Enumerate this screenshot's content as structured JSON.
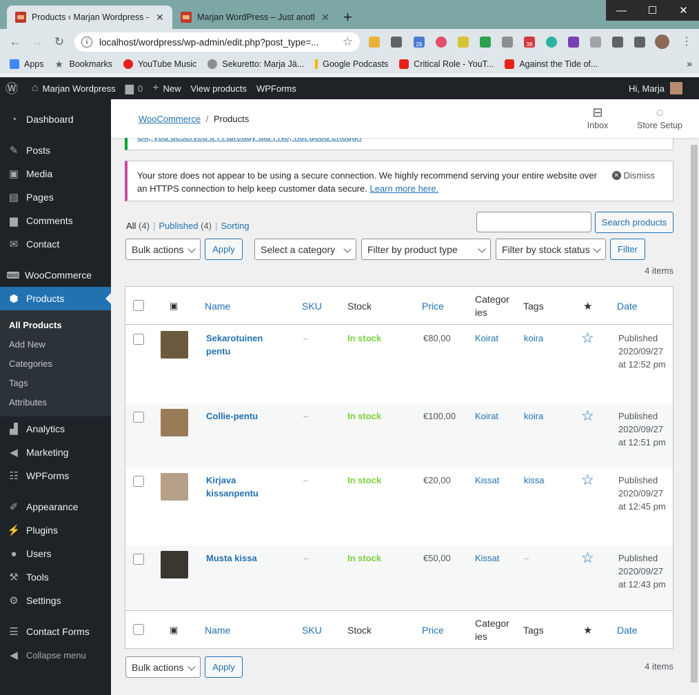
{
  "browser": {
    "tabs": [
      {
        "title": "Products ‹ Marjan Wordpress —",
        "active": true
      },
      {
        "title": "Marjan WordPress – Just another",
        "active": false
      }
    ],
    "url": "localhost/wordpress/wp-admin/edit.php?post_type=...",
    "extension_badge_calendar": "26",
    "extension_badge_count": "38",
    "bookmarks": [
      "Apps",
      "Bookmarks",
      "YouTube Music",
      "Sekuretto: Marja Jä...",
      "Google Podcasts",
      "Critical Role - YouT...",
      "Against the Tide of..."
    ]
  },
  "adminbar": {
    "site_name": "Marjan Wordpress",
    "comments_count": "0",
    "new_label": "New",
    "view_products": "View products",
    "wpforms": "WPForms",
    "greeting": "Hi, Marja"
  },
  "sidebar": {
    "items": [
      "Dashboard",
      "Posts",
      "Media",
      "Pages",
      "Comments",
      "Contact",
      "WooCommerce",
      "Products",
      "Analytics",
      "Marketing",
      "WPForms",
      "Appearance",
      "Plugins",
      "Users",
      "Tools",
      "Settings",
      "Contact Forms",
      "Collapse menu"
    ],
    "submenu": [
      "All Products",
      "Add New",
      "Categories",
      "Tags",
      "Attributes"
    ]
  },
  "wc_header": {
    "crumb_link": "WooCommerce",
    "crumb_sep": "/",
    "crumb_current": "Products",
    "inbox": "Inbox",
    "store_setup": "Store Setup"
  },
  "rating_notice": "Ok, you deserved it | I already did | No, not good enough",
  "ssl_notice": {
    "text": "Your store does not appear to be using a secure connection. We highly recommend serving your entire website over an HTTPS connection to help keep customer data secure.",
    "link": "Learn more here.",
    "dismiss": "Dismiss"
  },
  "views": {
    "all": "All",
    "all_count": "(4)",
    "published": "Published",
    "published_count": "(4)",
    "sorting": "Sorting"
  },
  "search": {
    "button": "Search products",
    "placeholder": ""
  },
  "filters": {
    "bulk_actions": "Bulk actions",
    "apply": "Apply",
    "category": "Select a category",
    "product_type": "Filter by product type",
    "stock_status": "Filter by stock status",
    "filter": "Filter"
  },
  "items_count": "4 items",
  "columns": {
    "name": "Name",
    "sku": "SKU",
    "stock": "Stock",
    "price": "Price",
    "categories_l1": "Categor",
    "categories_l2": "ies",
    "tags": "Tags",
    "date": "Date"
  },
  "products": [
    {
      "name_l1": "Sekarotuinen",
      "name_l2": "pentu",
      "sku": "–",
      "stock": "In stock",
      "price": "€80,00",
      "category": "Koirat",
      "tag": "koira",
      "status": "Published",
      "date": "2020/09/27",
      "time": "at 12:52 pm",
      "thumb": "#6b5a3e"
    },
    {
      "name_l1": "Collie-pentu",
      "name_l2": "",
      "sku": "–",
      "stock": "In stock",
      "price": "€100,00",
      "category": "Koirat",
      "tag": "koira",
      "status": "Published",
      "date": "2020/09/27",
      "time": "at 12:51 pm",
      "thumb": "#9a7b58"
    },
    {
      "name_l1": "Kirjava",
      "name_l2": "kissanpentu",
      "sku": "–",
      "stock": "In stock",
      "price": "€20,00",
      "category": "Kissat",
      "tag": "kissa",
      "status": "Published",
      "date": "2020/09/27",
      "time": "at 12:45 pm",
      "thumb": "#b6a08a"
    },
    {
      "name_l1": "Musta kissa",
      "name_l2": "",
      "sku": "–",
      "stock": "In stock",
      "price": "€50,00",
      "category": "Kissat",
      "tag": "–",
      "status": "Published",
      "date": "2020/09/27",
      "time": "at 12:43 pm",
      "thumb": "#3a3630"
    }
  ],
  "bottom": {
    "bulk_actions": "Bulk actions",
    "apply": "Apply",
    "items_count": "4 items"
  }
}
